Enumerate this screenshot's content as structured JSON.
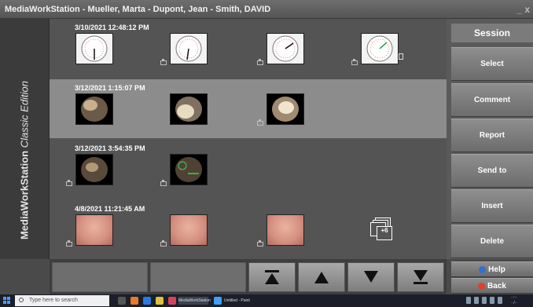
{
  "window": {
    "title": "MediaWorkStation - Mueller, Marta - Dupont, Jean - Smith, DAVID",
    "close_glyph": "_ x"
  },
  "brand": {
    "name": "MediaWorkStation",
    "edition": "Classic Edition"
  },
  "sessions": [
    {
      "date": "3/10/2021 12:48:12 PM",
      "type": "gauge",
      "count": 4
    },
    {
      "date": "3/12/2021 1:15:07 PM",
      "type": "endoscope",
      "count": 3,
      "selected": true
    },
    {
      "date": "3/12/2021 3:54:35 PM",
      "type": "endoscope",
      "count": 2
    },
    {
      "date": "4/8/2021 11:21:45 AM",
      "type": "skin",
      "count": 3,
      "more_label": "+6"
    }
  ],
  "actions": {
    "header": "Session",
    "buttons": [
      "Select",
      "Comment",
      "Report",
      "Send to",
      "Insert",
      "Delete"
    ],
    "help": "Help",
    "back": "Back"
  },
  "navigation": [
    "first-page",
    "previous-page",
    "next-page",
    "last-page"
  ],
  "taskbar": {
    "search_placeholder": "Type here to search",
    "app_mediaworkstation": "MediaWorkStation",
    "app_paint": "Untitled - Paint"
  },
  "colors": {
    "title_bar": "#5f5f5f",
    "selected_row": "#8c8c8c",
    "help_icon": "#2f6fd6",
    "back_icon": "#e0402a"
  }
}
